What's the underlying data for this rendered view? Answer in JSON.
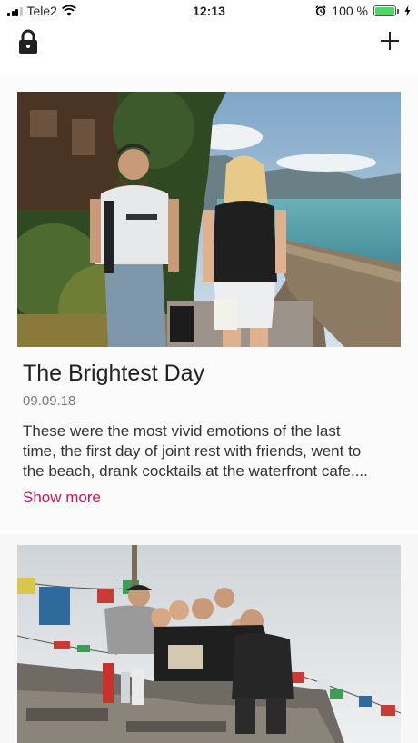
{
  "status_bar": {
    "carrier": "Tele2",
    "time": "12:13",
    "battery_percent": "100 %",
    "battery_level": 1.0,
    "icons": [
      "signal-icon",
      "wifi-icon",
      "alarm-icon",
      "battery-icon",
      "charging-icon"
    ]
  },
  "nav": {
    "left_icon": "lock-icon",
    "right_icon": "plus-icon"
  },
  "posts": [
    {
      "title": "The Brightest Day",
      "date": "09.09.18",
      "excerpt_lines": [
        "These were the most vivid emotions of the last",
        "time, the first day of joint rest with friends, went to",
        "the beach, drank cocktails at the waterfront cafe,..."
      ],
      "show_more": "Show more",
      "image": "couple-walking-lakeside-photo"
    },
    {
      "image": "group-of-friends-mountain-photo"
    }
  ],
  "colors": {
    "accent": "#c2185b",
    "battery_fill": "#4cd964"
  }
}
